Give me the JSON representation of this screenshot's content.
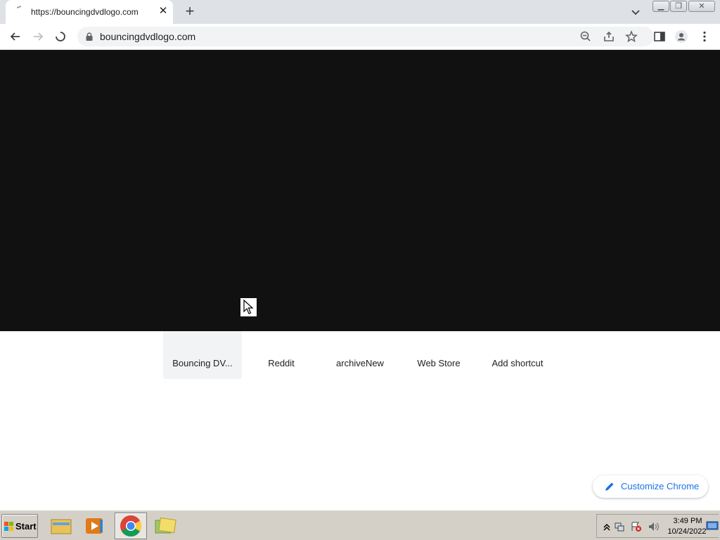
{
  "browser": {
    "tab": {
      "title": "https://bouncingdvdlogo.com",
      "close_glyph": "✕"
    },
    "new_tab_glyph": "+",
    "omnibox": {
      "url": "bouncingdvdlogo.com"
    }
  },
  "newtab": {
    "shortcuts": [
      {
        "label": "Bouncing DV...",
        "icon": "dvd-logo-icon",
        "color": "#0000cc"
      },
      {
        "label": "Reddit",
        "icon": "reddit-icon",
        "color": "#ff4500"
      },
      {
        "label": "archiveNew",
        "icon": "archive-icon",
        "color": "#e0245e"
      },
      {
        "label": "Web Store",
        "icon": "web-store-icon",
        "color": "#4285f4"
      },
      {
        "label": "Add shortcut",
        "icon": "plus-icon",
        "color": "#202124"
      }
    ],
    "customize_label": "Customize Chrome"
  },
  "overlay": {
    "color": "#111111"
  },
  "taskbar": {
    "start_label": "Start",
    "apps": [
      "file-explorer-icon",
      "media-player-icon",
      "chrome-icon",
      "folder-icon"
    ],
    "clock": {
      "time": "3:49 PM",
      "date": "10/24/2022"
    }
  }
}
